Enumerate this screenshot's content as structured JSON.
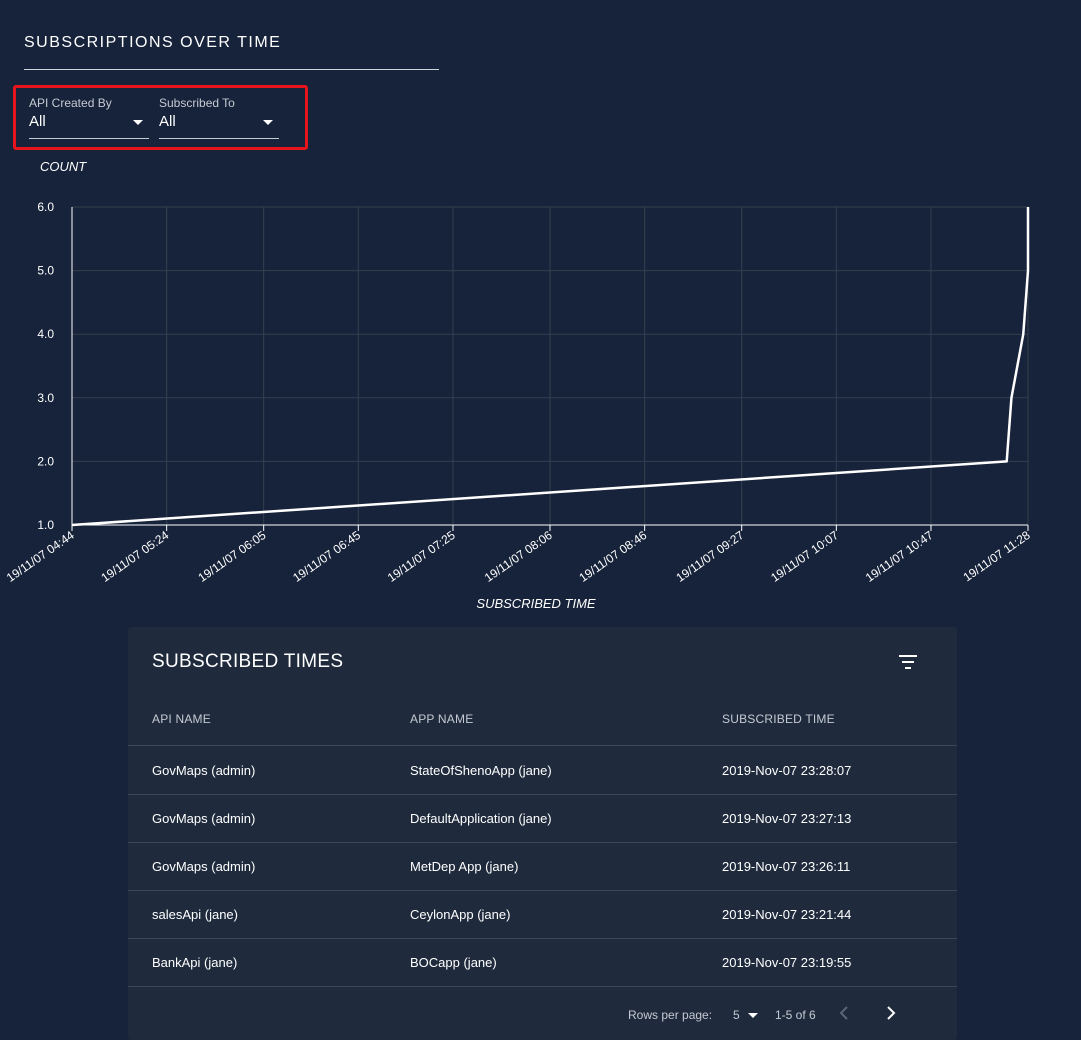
{
  "page": {
    "title": "SUBSCRIPTIONS OVER TIME"
  },
  "filters": {
    "api_created_by": {
      "label": "API Created By",
      "value": "All"
    },
    "subscribed_to": {
      "label": "Subscribed To",
      "value": "All"
    }
  },
  "chart_data": {
    "type": "line",
    "title": "",
    "xlabel": "SUBSCRIBED TIME",
    "ylabel": "COUNT",
    "ylim": [
      1.0,
      6.0
    ],
    "yticks": [
      "1.0",
      "2.0",
      "3.0",
      "4.0",
      "5.0",
      "6.0"
    ],
    "xticks": [
      "19/11/07 04:44",
      "19/11/07 05:24",
      "19/11/07 06:05",
      "19/11/07 06:45",
      "19/11/07 07:25",
      "19/11/07 08:06",
      "19/11/07 08:46",
      "19/11/07 09:27",
      "19/11/07 10:07",
      "19/11/07 10:47",
      "19/11/07 11:28"
    ],
    "grid": true,
    "line_color": "#ffffff",
    "series": [
      {
        "x": [
          "19/11/07 04:44",
          "19/11/07 11:19",
          "19/11/07 11:21",
          "19/11/07 11:26",
          "19/11/07 11:28",
          "19/11/07 11:28"
        ],
        "y": [
          1,
          2,
          3,
          4,
          5,
          6
        ]
      }
    ]
  },
  "table": {
    "title": "SUBSCRIBED TIMES",
    "columns": [
      "API NAME",
      "APP NAME",
      "SUBSCRIBED TIME"
    ],
    "rows": [
      [
        "GovMaps (admin)",
        "StateOfShenoApp (jane)",
        "2019-Nov-07 23:28:07"
      ],
      [
        "GovMaps (admin)",
        "DefaultApplication (jane)",
        "2019-Nov-07 23:27:13"
      ],
      [
        "GovMaps (admin)",
        "MetDep App (jane)",
        "2019-Nov-07 23:26:11"
      ],
      [
        "salesApi (jane)",
        "CeylonApp (jane)",
        "2019-Nov-07 23:21:44"
      ],
      [
        "BankApi (jane)",
        "BOCapp (jane)",
        "2019-Nov-07 23:19:55"
      ]
    ],
    "pagination": {
      "rows_per_page_label": "Rows per page:",
      "rows_per_page": "5",
      "range": "1-5 of 6"
    }
  },
  "icons": {
    "filter": "filter-list-icon",
    "prev": "chevron-left-icon",
    "next": "chevron-right-icon",
    "dropdown": "arrow-drop-down-icon"
  },
  "colors": {
    "background": "#17233a",
    "card": "#1f2b3d",
    "highlight_border": "#e8141b",
    "grid": "#34404f",
    "text_muted": "#c5cad3"
  }
}
